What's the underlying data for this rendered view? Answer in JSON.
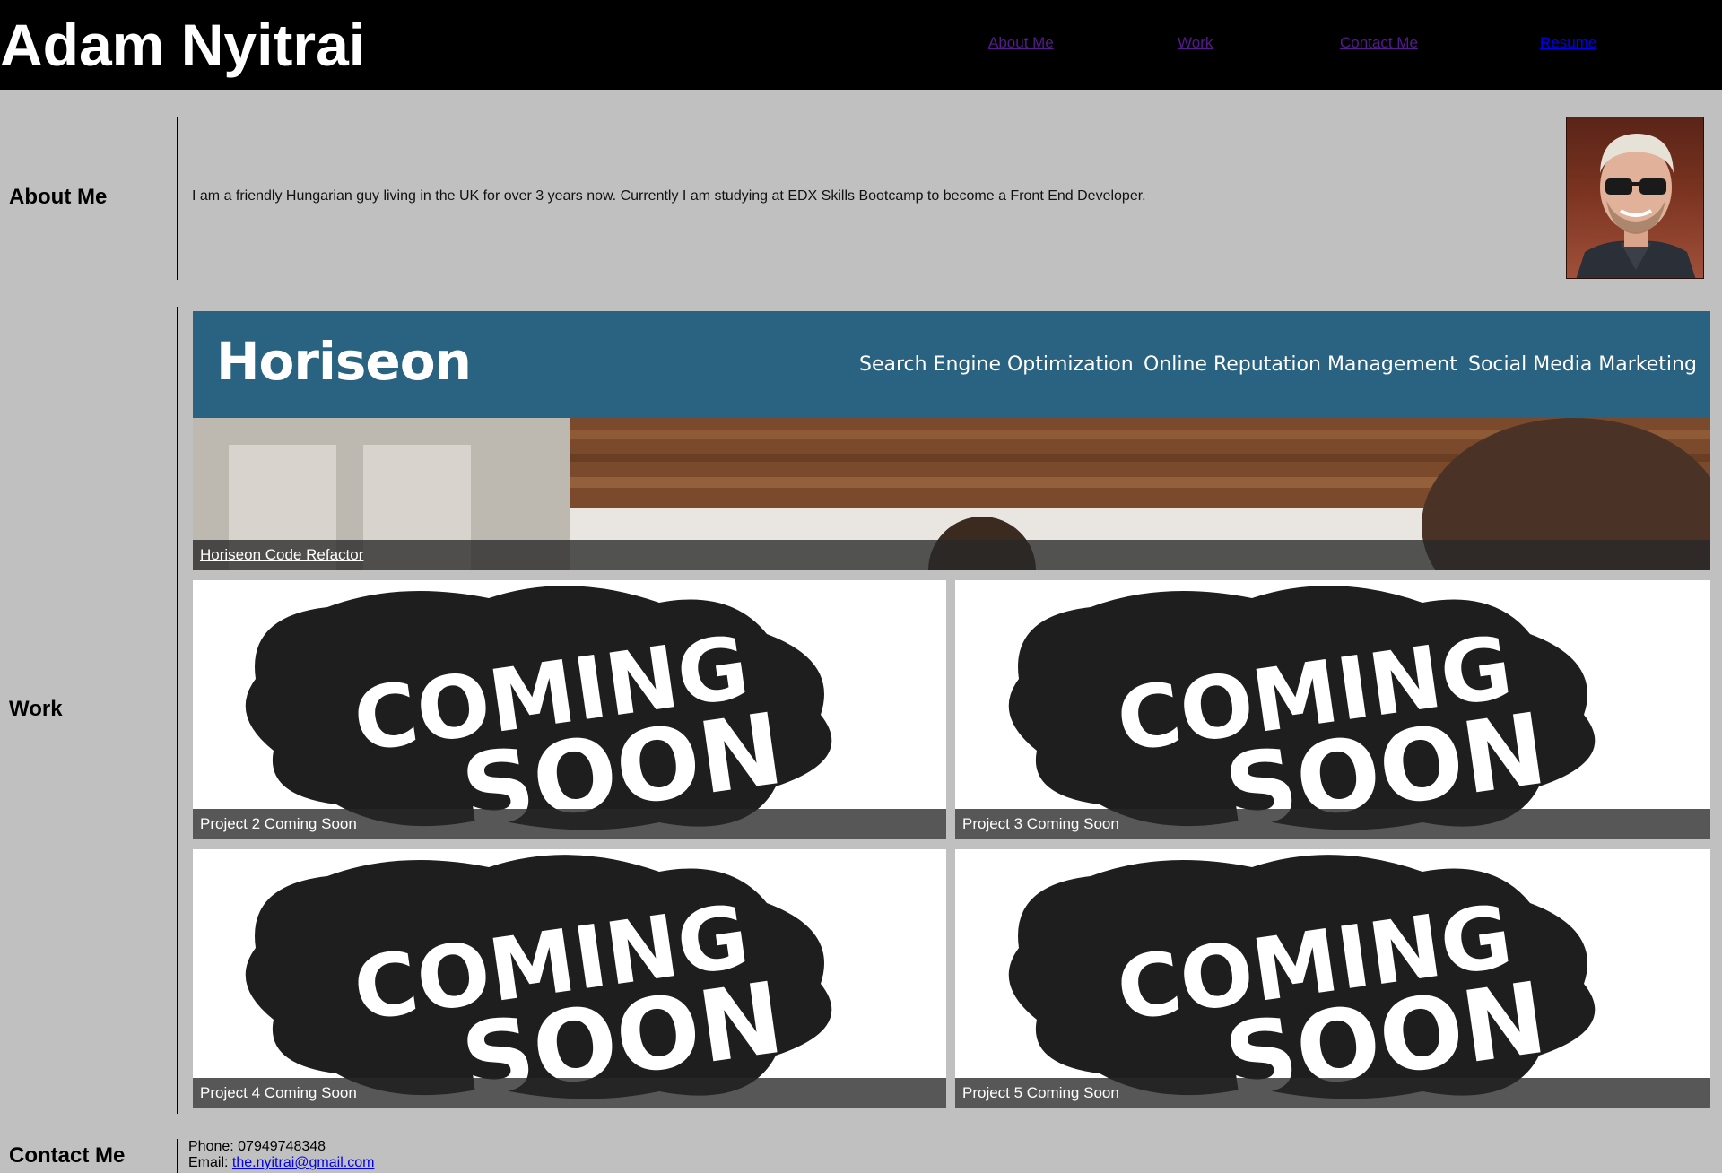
{
  "header": {
    "site_title": "Adam Nyitrai",
    "nav": {
      "about": "About Me",
      "work": "Work",
      "contact": "Contact Me",
      "resume": "Resume"
    }
  },
  "about": {
    "heading": "About Me",
    "text": "I am a friendly Hungarian guy living in the UK for over 3 years now. Currently I am studying at EDX Skills Bootcamp to become a Front End Developer.",
    "avatar_icon": "profile-photo"
  },
  "work": {
    "heading": "Work",
    "featured": {
      "caption": "Horiseon Code Refactor",
      "banner_logo": "Horiseon",
      "banner_menu": [
        "Search Engine Optimization",
        "Online Reputation Management",
        "Social Media Marketing"
      ]
    },
    "projects": [
      {
        "caption": "Project 2 Coming Soon",
        "image_line1": "COMING",
        "image_line2": "SOON"
      },
      {
        "caption": "Project 3 Coming Soon",
        "image_line1": "COMING",
        "image_line2": "SOON"
      },
      {
        "caption": "Project 4 Coming Soon",
        "image_line1": "COMING",
        "image_line2": "SOON"
      },
      {
        "caption": "Project 5 Coming Soon",
        "image_line1": "COMING",
        "image_line2": "SOON"
      }
    ]
  },
  "contact": {
    "heading": "Contact Me",
    "phone_label": "Phone: ",
    "phone": "07949748348",
    "email_label": "Email: ",
    "email": "the.nyitrai@gmail.com"
  },
  "colors": {
    "header_bg": "#000000",
    "page_bg": "#c0c0c0",
    "banner_blue": "#2a6381",
    "link_visited": "#551a8b",
    "link_unvisited": "#0000ee"
  }
}
